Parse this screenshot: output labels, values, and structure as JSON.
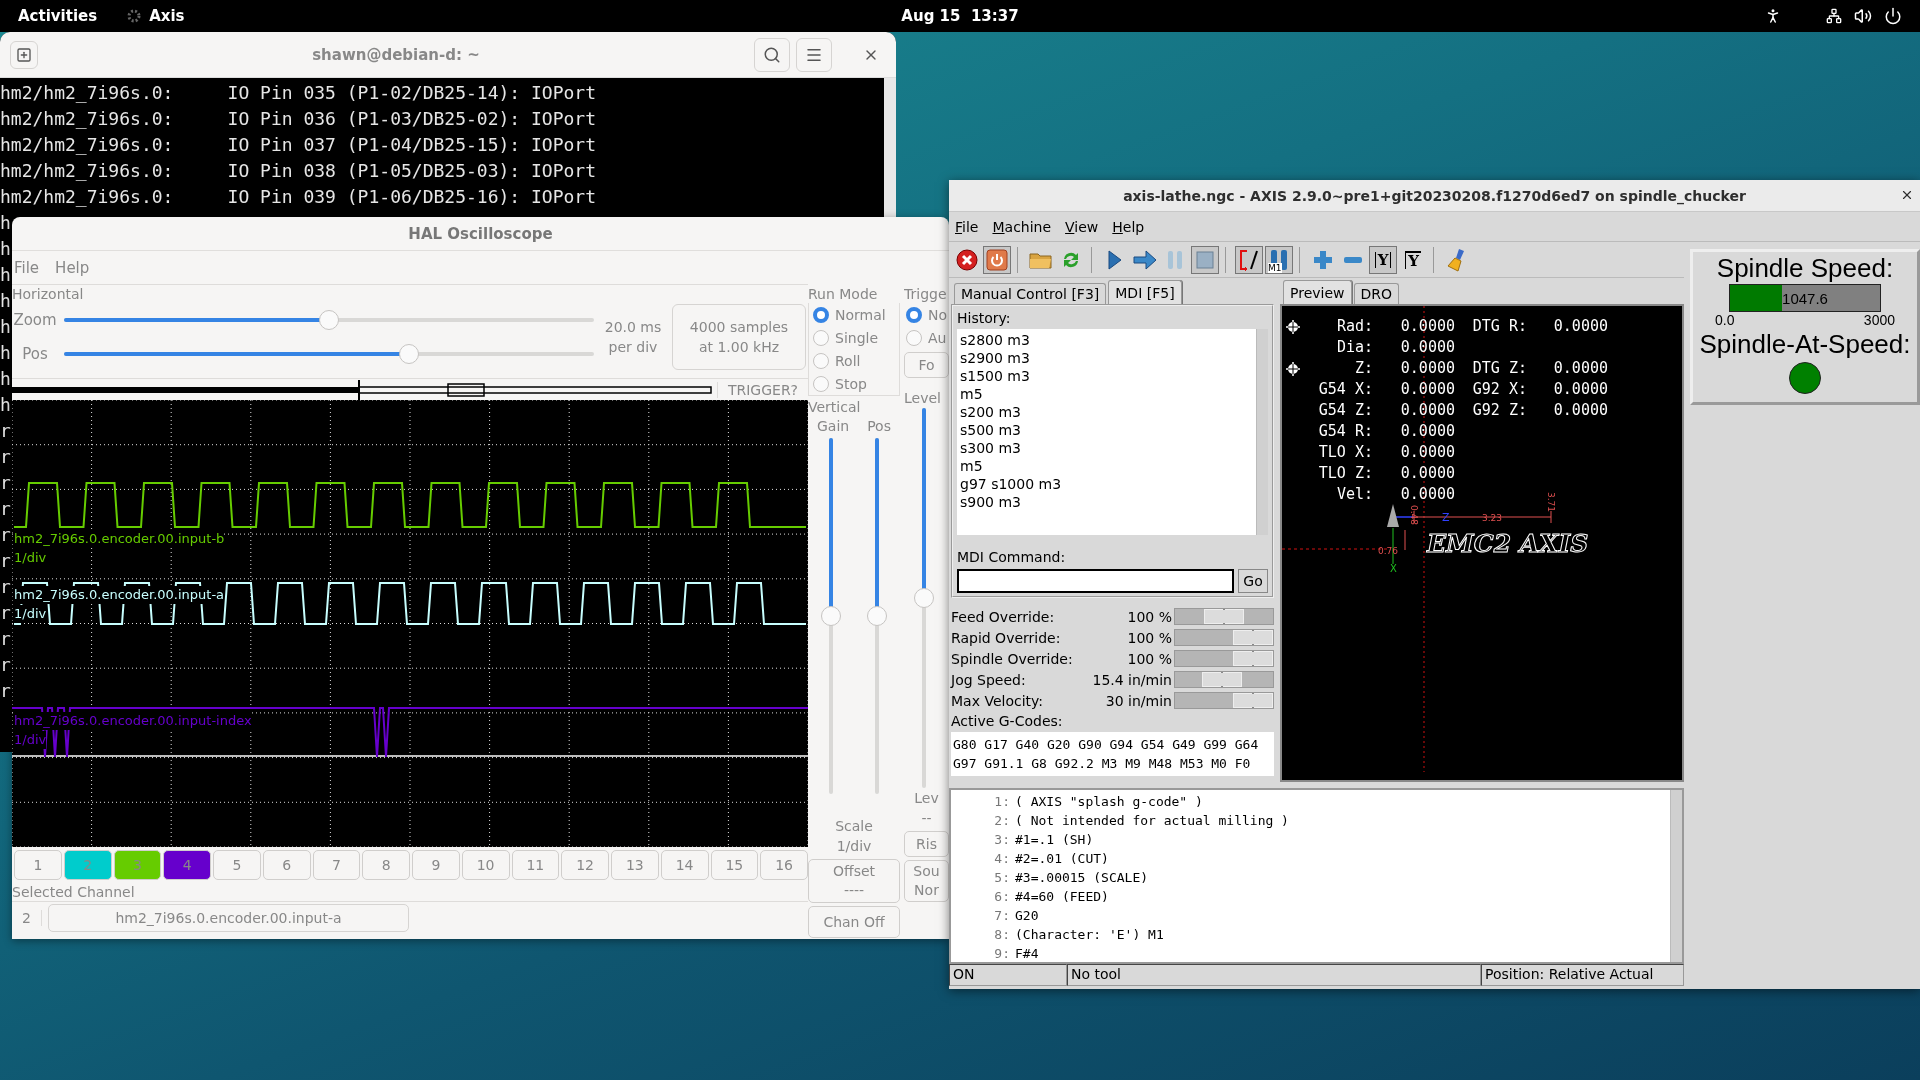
{
  "top_bar": {
    "activities": "Activities",
    "app": "Axis",
    "clock": "Aug 15  13:37"
  },
  "terminal": {
    "title": "shawn@debian-d: ~",
    "lines": [
      "hm2/hm2_7i96s.0:     IO Pin 035 (P1-02/DB25-14): IOPort",
      "hm2/hm2_7i96s.0:     IO Pin 036 (P1-03/DB25-02): IOPort",
      "hm2/hm2_7i96s.0:     IO Pin 037 (P1-04/DB25-15): IOPort",
      "hm2/hm2_7i96s.0:     IO Pin 038 (P1-05/DB25-03): IOPort",
      "hm2/hm2_7i96s.0:     IO Pin 039 (P1-06/DB25-16): IOPort"
    ],
    "fragments": [
      "h",
      "h",
      "h",
      "h",
      "h",
      "h",
      "h",
      "h",
      "r",
      "r",
      "r",
      "r",
      "r",
      "r",
      "r",
      "r",
      "r",
      "r",
      "r"
    ]
  },
  "scope": {
    "title": "HAL Oscilloscope",
    "menu": [
      "File",
      "Help"
    ],
    "horizontal": {
      "legend": "Horizontal",
      "zoom": {
        "label": "Zoom",
        "level": 0.5
      },
      "pos": {
        "label": "Pos",
        "level": 0.65
      },
      "rate": [
        "20.0 ms",
        "per div"
      ],
      "samples": [
        "4000 samples",
        "at 1.00 kHz"
      ]
    },
    "trigger_text": "TRIGGER?",
    "channel_labels": [
      {
        "name": "hm2_7i96s.0.encoder.00.input-b",
        "scale": "1/div",
        "color": "#66cc00"
      },
      {
        "name": "hm2_7i96s.0.encoder.00.input-a",
        "scale": "1/div",
        "color": "#c8ffff"
      },
      {
        "name": "hm2_7i96s.0.encoder.00.input-index",
        "scale": "1/div",
        "color": "#6600cc"
      }
    ],
    "channels": [
      {
        "label": "1"
      },
      {
        "label": "2",
        "color": "#00cccc"
      },
      {
        "label": "3",
        "color": "#66cc00"
      },
      {
        "label": "4",
        "color": "#6600cc"
      },
      {
        "label": "5"
      },
      {
        "label": "6"
      },
      {
        "label": "7"
      },
      {
        "label": "8"
      },
      {
        "label": "9"
      },
      {
        "label": "10"
      },
      {
        "label": "11"
      },
      {
        "label": "12"
      },
      {
        "label": "13"
      },
      {
        "label": "14"
      },
      {
        "label": "15"
      },
      {
        "label": "16"
      }
    ],
    "selected_channel": {
      "legend": "Selected Channel",
      "number": "2",
      "name": "hm2_7i96s.0.encoder.00.input-a"
    },
    "run_mode": {
      "legend": "Run Mode",
      "options": [
        {
          "label": "Normal",
          "selected": true
        },
        {
          "label": "Single",
          "selected": false
        },
        {
          "label": "Roll",
          "selected": false
        },
        {
          "label": "Stop",
          "selected": false
        }
      ]
    },
    "vertical": {
      "legend": "Vertical",
      "gain": {
        "label": "Gain",
        "level": 0.5
      },
      "pos": {
        "label": "Pos",
        "level": 0.5
      },
      "scale_label": "Scale",
      "scale": "1/div",
      "offset": {
        "label": "Offset",
        "value": "----"
      },
      "chan_off": "Chan Off"
    },
    "trigger": {
      "legend": "Trigge",
      "options": [
        {
          "label": "No",
          "selected": true
        },
        {
          "label": "Au",
          "selected": false
        }
      ],
      "force": "Fo",
      "level_label": "Level",
      "level": 0.5,
      "level_caption": "Lev",
      "level_value": "--",
      "rise": "Ris",
      "source": [
        "Sou",
        "Nor"
      ]
    }
  },
  "axis": {
    "title": "axis-lathe.ngc - AXIS 2.9.0~pre1+git20230208.f1270d6ed7 on spindle_chucker",
    "menu": [
      "File",
      "Machine",
      "View",
      "Help"
    ],
    "toolbar": [
      {
        "kind": "estop",
        "pressed": false
      },
      {
        "kind": "power",
        "pressed": true
      },
      {
        "kind": "separator"
      },
      {
        "kind": "open",
        "pressed": false
      },
      {
        "kind": "reload",
        "pressed": false
      },
      {
        "kind": "separator"
      },
      {
        "kind": "run",
        "pressed": false
      },
      {
        "kind": "step",
        "pressed": false
      },
      {
        "kind": "pause",
        "pressed": false
      },
      {
        "kind": "stop",
        "pressed": true
      },
      {
        "kind": "separator"
      },
      {
        "kind": "block_delete",
        "pressed": true
      },
      {
        "kind": "optional_stop",
        "pressed": true,
        "glyph": "M1"
      },
      {
        "kind": "separator"
      },
      {
        "kind": "zoom_in",
        "pressed": false
      },
      {
        "kind": "zoom_out",
        "pressed": false
      },
      {
        "kind": "view_y",
        "pressed": true,
        "glyph": "Y"
      },
      {
        "kind": "view_y2",
        "pressed": false,
        "glyph": "Y"
      },
      {
        "kind": "separator"
      },
      {
        "kind": "clear",
        "pressed": false
      }
    ],
    "tabs": [
      {
        "label": "Manual Control [F3]",
        "selected": false
      },
      {
        "label": "MDI [F5]",
        "selected": true
      }
    ],
    "mdi": {
      "history_label": "History:",
      "history": [
        "s2800 m3",
        "s2900 m3",
        "s1500 m3",
        "m5",
        "s200 m3",
        "s500 m3",
        "s300 m3",
        "m5",
        "g97 s1000 m3",
        "s900 m3"
      ],
      "command_label": "MDI Command:",
      "go": "Go"
    },
    "overrides": [
      {
        "label": "Feed Override:",
        "value": "100 %",
        "level": 0.5
      },
      {
        "label": "Rapid Override:",
        "value": "100 %",
        "level": 1
      },
      {
        "label": "Spindle Override:",
        "value": "100 %",
        "level": 1
      },
      {
        "label": "Jog Speed:",
        "value": "15.4 in/min",
        "level": 0.47
      },
      {
        "label": "Max Velocity:",
        "value": "30 in/min",
        "level": 1
      }
    ],
    "active_gcodes": {
      "label": "Active G-Codes:",
      "lines": [
        "G80 G17 G40 G20 G90 G94 G54 G49 G99 G64",
        "G97 G91.1 G8 G92.2 M3 M9 M48 M53 M0 F0"
      ]
    },
    "preview_tabs": [
      {
        "label": "Preview",
        "selected": true
      },
      {
        "label": "DRO",
        "selected": false
      }
    ],
    "dro": [
      {
        "label": "Rad:",
        "value": "0.0000",
        "label2": "DTG R:",
        "value2": "0.0000",
        "homed": true
      },
      {
        "label": "Dia:",
        "value": "0.0000",
        "homed": false
      },
      {
        "label": "Z:",
        "value": "0.0000",
        "label2": "DTG Z:",
        "value2": "0.0000",
        "homed": true
      },
      {
        "label": "G54 X:",
        "value": "0.0000",
        "label2": "G92 X:",
        "value2": "0.0000",
        "homed": false
      },
      {
        "label": "G54 Z:",
        "value": "0.0000",
        "label2": "G92 Z:",
        "value2": "0.0000",
        "homed": false
      },
      {
        "label": "G54 R:",
        "value": "0.0000",
        "homed": false
      },
      {
        "label": "TLO X:",
        "value": "0.0000",
        "homed": false
      },
      {
        "label": "TLO Z:",
        "value": "0.0000",
        "homed": false
      },
      {
        "label": "Vel:",
        "value": "0.0000",
        "homed": false
      }
    ],
    "plot": {
      "splash": "EMC2 AXIS",
      "dims": [
        "3.23",
        "0.48",
        "3.71",
        "0.76"
      ],
      "axes": [
        "Z",
        "X"
      ]
    },
    "gcode": [
      {
        "n": "1:",
        "text": "( AXIS \"splash g-code\" )"
      },
      {
        "n": "2:",
        "text": "( Not intended for actual milling )"
      },
      {
        "n": "3:",
        "text": "#1=.1 (SH)"
      },
      {
        "n": "4:",
        "text": "#2=.01 (CUT)"
      },
      {
        "n": "5:",
        "text": "#3=.00015 (SCALE)"
      },
      {
        "n": "6:",
        "text": "#4=60 (FEED)"
      },
      {
        "n": "7:",
        "text": "G20"
      },
      {
        "n": "8:",
        "text": "(Character: 'E') M1"
      },
      {
        "n": "9:",
        "text": "F#4"
      }
    ],
    "status": [
      "ON",
      "No tool",
      "Position: Relative Actual"
    ],
    "spindle": {
      "speed_label": "Spindle Speed:",
      "speed": "1047.6",
      "level": 0.349,
      "min": "0.0",
      "max": "3000",
      "at_speed_label": "Spindle-At-Speed:",
      "at_speed": true
    }
  }
}
